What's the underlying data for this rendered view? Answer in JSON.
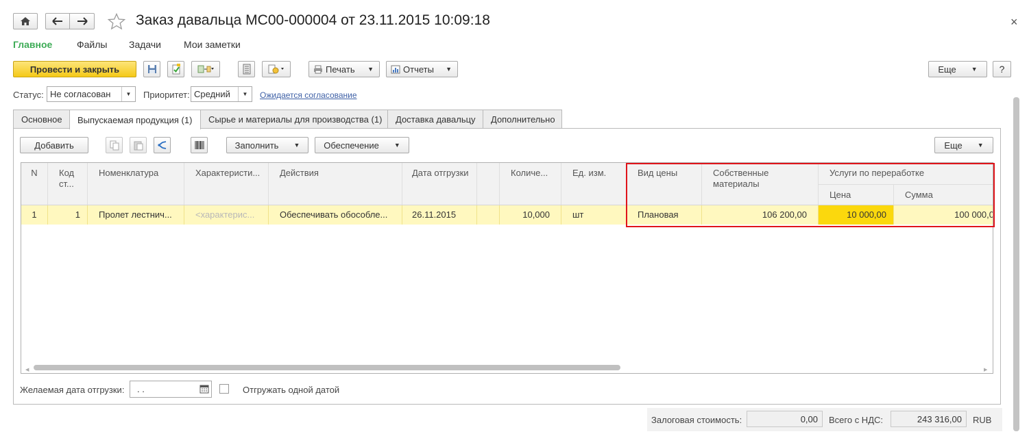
{
  "window": {
    "title": "Заказ давальца МС00-000004 от 23.11.2015 10:09:18",
    "close_glyph": "×"
  },
  "nav": [
    {
      "label": "Главное",
      "active": true
    },
    {
      "label": "Файлы",
      "active": false
    },
    {
      "label": "Задачи",
      "active": false
    },
    {
      "label": "Мои заметки",
      "active": false
    }
  ],
  "toolbar": {
    "post_close_label": "Провести и закрыть",
    "print_label": "Печать",
    "reports_label": "Отчеты",
    "more_label": "Еще",
    "help_label": "?"
  },
  "status_row": {
    "status_label": "Статус:",
    "status_value": "Не согласован",
    "priority_label": "Приоритет:",
    "priority_value": "Средний",
    "approval_link": "Ожидается согласование"
  },
  "tabs": [
    {
      "label": "Основное"
    },
    {
      "label": "Выпускаемая продукция (1)"
    },
    {
      "label": "Сырье и материалы для производства (1)"
    },
    {
      "label": "Доставка давальцу"
    },
    {
      "label": "Дополнительно"
    }
  ],
  "table_toolbar": {
    "add_label": "Добавить",
    "fill_label": "Заполнить",
    "provision_label": "Обеспечение",
    "more_label": "Еще"
  },
  "table": {
    "headers": {
      "n": "N",
      "code": "Код ст...",
      "nomenclature": "Номенклатура",
      "characteristic": "Характеристи...",
      "actions": "Действия",
      "ship_date": "Дата отгрузки",
      "quantity": "Количе...",
      "unit": "Ед. изм.",
      "price_type": "Вид цены",
      "own_materials": "Собственные материалы",
      "processing": "Услуги по переработке",
      "processing_price": "Цена",
      "processing_sum": "Сумма"
    },
    "rows": [
      {
        "n": "1",
        "code": "1",
        "nomenclature": "Пролет лестнич...",
        "characteristic": "<характерис...",
        "actions": "Обеспечивать обособле...",
        "ship_date": "26.11.2015",
        "quantity": "10,000",
        "unit": "шт",
        "price_type": "Плановая",
        "own_materials": "106 200,00",
        "processing_price": "10 000,00",
        "processing_sum": "100 000,0"
      }
    ]
  },
  "bottom": {
    "desired_date_label": "Желаемая дата отгрузки:",
    "desired_date_value": " .  .",
    "ship_one_date_label": "Отгружать одной датой"
  },
  "footer": {
    "deposit_label": "Залоговая стоимость:",
    "deposit_value": "0,00",
    "total_label": "Всего с НДС:",
    "total_value": "243 316,00",
    "currency": "RUB"
  }
}
